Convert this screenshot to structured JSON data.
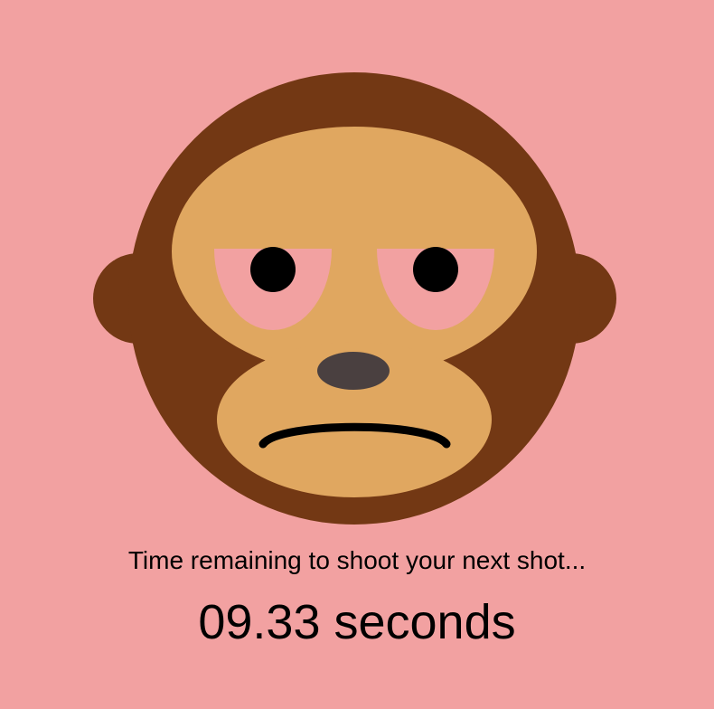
{
  "scene": {
    "background": "#f2a1a1",
    "character": "monkey-face",
    "mood": "frown"
  },
  "colors": {
    "fur": "#733814",
    "face": "#e0a760",
    "eye_patch": "#f2a1a1",
    "pupil": "#000000",
    "nose": "#4a4040",
    "mouth": "#000000"
  },
  "hud": {
    "prompt": "Time remaining to shoot your next shot...",
    "timer_value": "09.33",
    "timer_unit": "seconds",
    "timer_text": "09.33 seconds"
  }
}
